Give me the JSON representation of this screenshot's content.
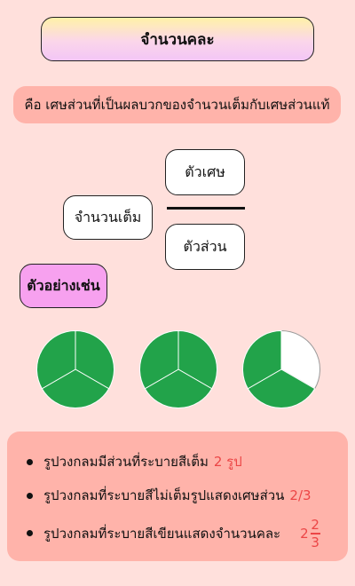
{
  "title": "จำนวนคละ",
  "definition": "คือ เศษส่วนที่เป็นผลบวกของจำนวนเต็มกับเศษส่วนแท้",
  "diagram": {
    "whole_label": "จำนวนเต็ม",
    "numerator_label": "ตัวเศษ",
    "denominator_label": "ตัวส่วน"
  },
  "example_label": "ตัวอย่างเช่น",
  "pies": [
    {
      "shaded": 3,
      "parts": 3
    },
    {
      "shaded": 3,
      "parts": 3
    },
    {
      "shaded": 2,
      "parts": 3
    }
  ],
  "summary": {
    "line1_text": "รูปวงกลมมีส่วนที่ระบายสีเต็ม",
    "line1_value": "2 รูป",
    "line2_text": "รูปวงกลมที่ระบายสีไม่เต็มรูปแสดงเศษส่วน",
    "line2_value": "2/3",
    "line3_text": "รูปวงกลมที่ระบายสีเขียนแสดงจำนวนคละ",
    "mixed_whole": "2",
    "mixed_num": "2",
    "mixed_den": "3"
  },
  "colors": {
    "background": "#ffe0dc",
    "accent_red": "#ec4646",
    "pie_green": "#22a34a",
    "panel": "#ffb3aa"
  }
}
